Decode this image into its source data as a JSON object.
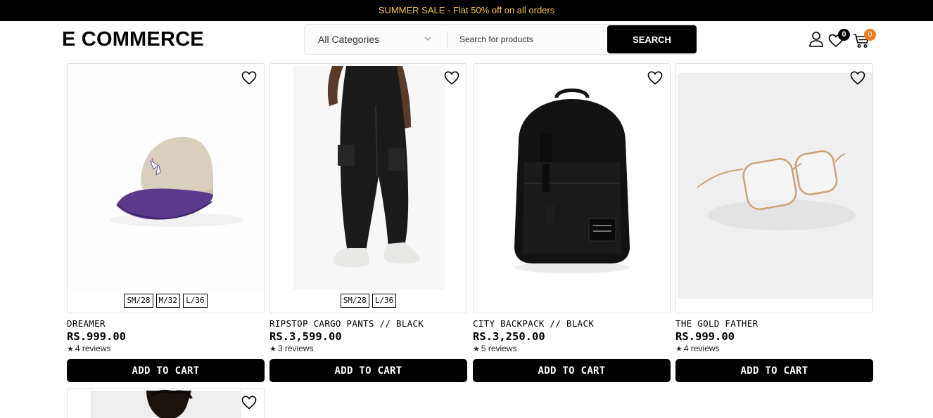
{
  "promo": {
    "text": "SUMMER SALE - Flat 50% off on all orders"
  },
  "header": {
    "brand": "E COMMERCE",
    "category": "All Categories",
    "search_placeholder": "Search for products",
    "search_label": "SEARCH",
    "wishlist_count": "0",
    "cart_count": "0",
    "icons": [
      "user-icon",
      "heart-icon",
      "cart-icon"
    ]
  },
  "products": [
    {
      "name": "DREAMER",
      "price": "RS.999.00",
      "reviews": "4 reviews",
      "sizes": [
        "SM/28",
        "M/32",
        "L/36"
      ],
      "image": "cap-image"
    },
    {
      "name": "RIPSTOP CARGO PANTS // BLACK",
      "price": "RS.3,599.00",
      "reviews": "3 reviews",
      "sizes": [
        "SM/28",
        "L/36"
      ],
      "image": "cargo-pants-image"
    },
    {
      "name": "CITY BACKPACK // BLACK",
      "price": "RS.3,250.00",
      "reviews": "5 reviews",
      "sizes": [],
      "image": "backpack-image"
    },
    {
      "name": "THE GOLD FATHER",
      "price": "RS.999.00",
      "reviews": "4 reviews",
      "sizes": [],
      "image": "glasses-image"
    }
  ],
  "add_to_cart_label": "ADD TO CART",
  "colors": {
    "promo_text": "#f5c842",
    "cart_badge": "#f07c1e",
    "primary": "#000000"
  }
}
